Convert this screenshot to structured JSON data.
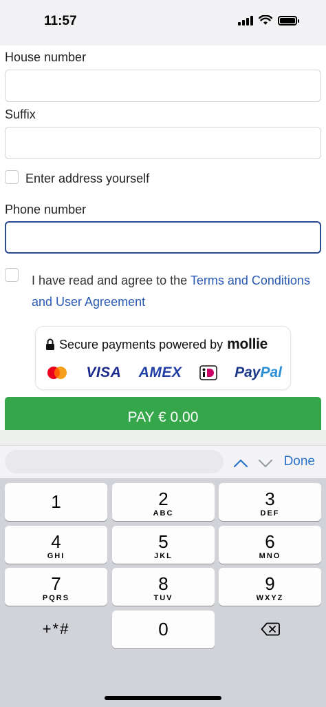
{
  "status_bar": {
    "time": "11:57"
  },
  "form": {
    "house_number": {
      "label": "House number",
      "value": ""
    },
    "suffix": {
      "label": "Suffix",
      "value": ""
    },
    "enter_address": {
      "label": "Enter address yourself",
      "checked": false
    },
    "phone_number": {
      "label": "Phone number",
      "value": ""
    },
    "terms": {
      "text_before": "I have read and agree to the ",
      "link_text": "Terms and Conditions and User Agreement",
      "checked": false
    }
  },
  "payment_badge": {
    "text": "Secure payments powered by",
    "brand": "mollie",
    "logos": {
      "mastercard": "mastercard-icon",
      "visa": "VISA",
      "amex": "AMEX",
      "ideal": "ideal-icon",
      "paypal_part1": "Pay",
      "paypal_part2": "Pal"
    }
  },
  "pay_button": {
    "label": "PAY € 0.00",
    "color": "#36a64a"
  },
  "keyboard_accessory": {
    "done_label": "Done",
    "accent": "#2a72c9"
  },
  "keypad": {
    "keys": [
      {
        "num": "1",
        "letters": ""
      },
      {
        "num": "2",
        "letters": "ABC"
      },
      {
        "num": "3",
        "letters": "DEF"
      },
      {
        "num": "4",
        "letters": "GHI"
      },
      {
        "num": "5",
        "letters": "JKL"
      },
      {
        "num": "6",
        "letters": "MNO"
      },
      {
        "num": "7",
        "letters": "PQRS"
      },
      {
        "num": "8",
        "letters": "TUV"
      },
      {
        "num": "9",
        "letters": "WXYZ"
      },
      {
        "num": "0",
        "letters": ""
      }
    ],
    "symbols_label": "+*#",
    "delete_icon": "backspace-icon"
  }
}
